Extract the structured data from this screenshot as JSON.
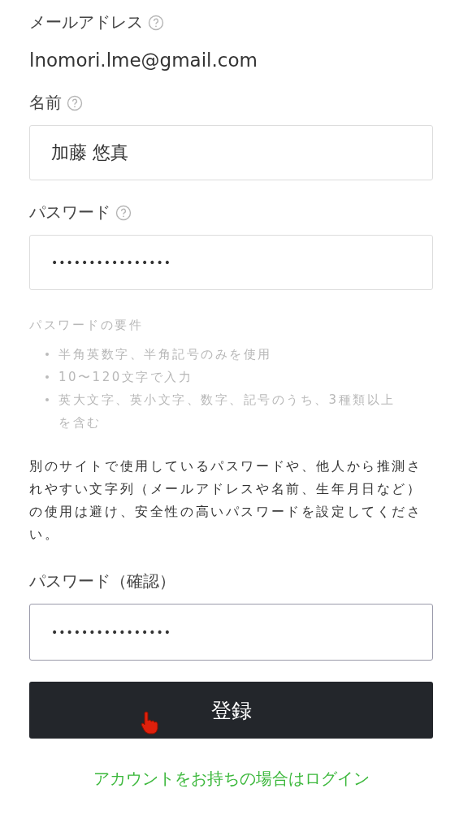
{
  "fields": [
    {
      "kind": "static",
      "label": "メールアドレス",
      "help": true,
      "value": "lnomori.lme@gmail.com"
    },
    {
      "kind": "input",
      "label": "名前",
      "help": true,
      "value": "加藤 悠真",
      "focused": false
    },
    {
      "kind": "input",
      "label": "パスワード",
      "help": true,
      "value": "••••••••••••••••",
      "focused": false
    },
    {
      "kind": "requirements",
      "title": "パスワードの要件",
      "items": [
        "半角英数字、半角記号のみを使用",
        "10〜120文字で入力",
        "英大文字、英小文字、数字、記号のうち、3種類以上を含む"
      ]
    },
    {
      "kind": "note",
      "text": "別のサイトで使用しているパスワードや、他人から推測されやすい文字列（メールアドレスや名前、生年月日など）の使用は避け、安全性の高いパスワードを設定してください。"
    },
    {
      "kind": "input",
      "label": "パスワード（確認）",
      "help": false,
      "value": "••••••••••••••••",
      "focused": true
    }
  ],
  "submit_button": {
    "label": "登録"
  },
  "login_link": {
    "text": "アカウントをお持ちの場合はログイン"
  }
}
